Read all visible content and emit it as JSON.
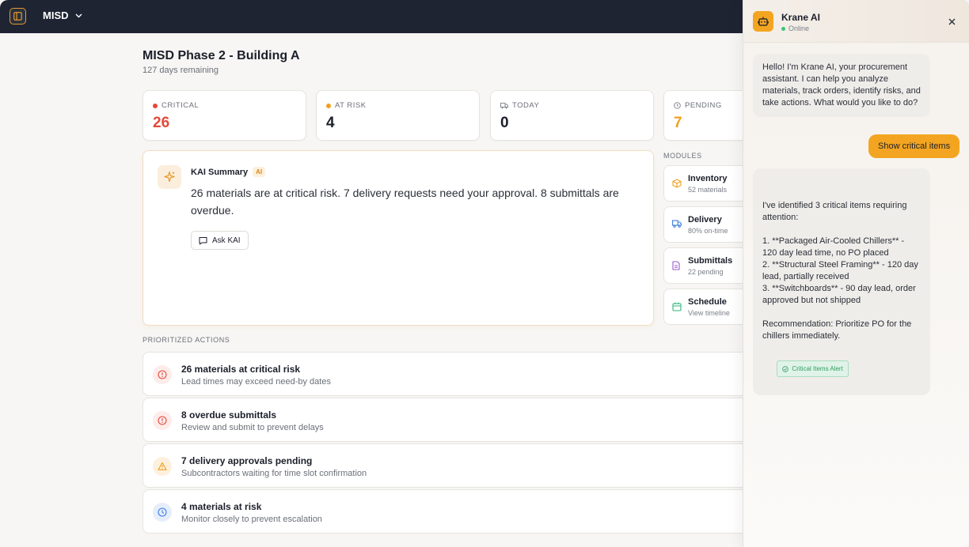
{
  "topbar": {
    "project": "MISD"
  },
  "project": {
    "title": "MISD Phase 2 - Building A",
    "remaining": "127 days remaining"
  },
  "stats": [
    {
      "label": "CRITICAL",
      "value": "26",
      "color": "#e5483b"
    },
    {
      "label": "AT RISK",
      "value": "4",
      "color": "#f0a020"
    },
    {
      "label": "TODAY",
      "value": "0",
      "color": "#1c1f2a"
    },
    {
      "label": "PENDING",
      "value": "7",
      "color": "#f0a020"
    }
  ],
  "summary": {
    "title": "KAI Summary",
    "badge": "AI",
    "text": "26 materials are at critical risk. 7 delivery requests need your approval. 8 submittals are overdue.",
    "ask_button": "Ask KAI"
  },
  "modules": {
    "label": "MODULES",
    "items": [
      {
        "name": "Inventory",
        "sub": "52 materials",
        "icon": "box-icon",
        "color": "#f0a020"
      },
      {
        "name": "Delivery",
        "sub": "80% on-time",
        "icon": "truck-icon",
        "color": "#3b7ddd"
      },
      {
        "name": "Submittals",
        "sub": "22 pending",
        "icon": "document-icon",
        "color": "#9b59d0"
      },
      {
        "name": "Schedule",
        "sub": "View timeline",
        "icon": "calendar-icon",
        "color": "#2fb67a"
      }
    ]
  },
  "actions": {
    "label": "PRIORITIZED ACTIONS",
    "items": [
      {
        "title": "26 materials at critical risk",
        "sub": "Lead times may exceed need-by dates",
        "icon": "alert-circle-icon"
      },
      {
        "title": "8 overdue submittals",
        "sub": "Review and submit to prevent delays",
        "icon": "alert-circle-icon"
      },
      {
        "title": "7 delivery approvals pending",
        "sub": "Subcontractors waiting for time slot confirmation",
        "icon": "warning-triangle-icon"
      },
      {
        "title": "4 materials at risk",
        "sub": "Monitor closely to prevent escalation",
        "icon": "clock-icon"
      }
    ]
  },
  "chat": {
    "name": "Krane AI",
    "status": "Online",
    "messages": {
      "greeting": "Hello! I'm Krane AI, your procurement assistant. I can help you analyze materials, track orders, identify risks, and take actions. What would you like to do?",
      "user": "Show critical items",
      "reply": "I've identified 3 critical items requiring attention:\n\n1. **Packaged Air-Cooled Chillers** - 120 day lead time, no PO placed\n2. **Structural Steel Framing** - 120 day lead, partially received\n3. **Switchboards** - 90 day lead, order approved but not shipped\n\nRecommendation: Prioritize PO for the chillers immediately.",
      "tag": "Critical Items Alert"
    }
  }
}
